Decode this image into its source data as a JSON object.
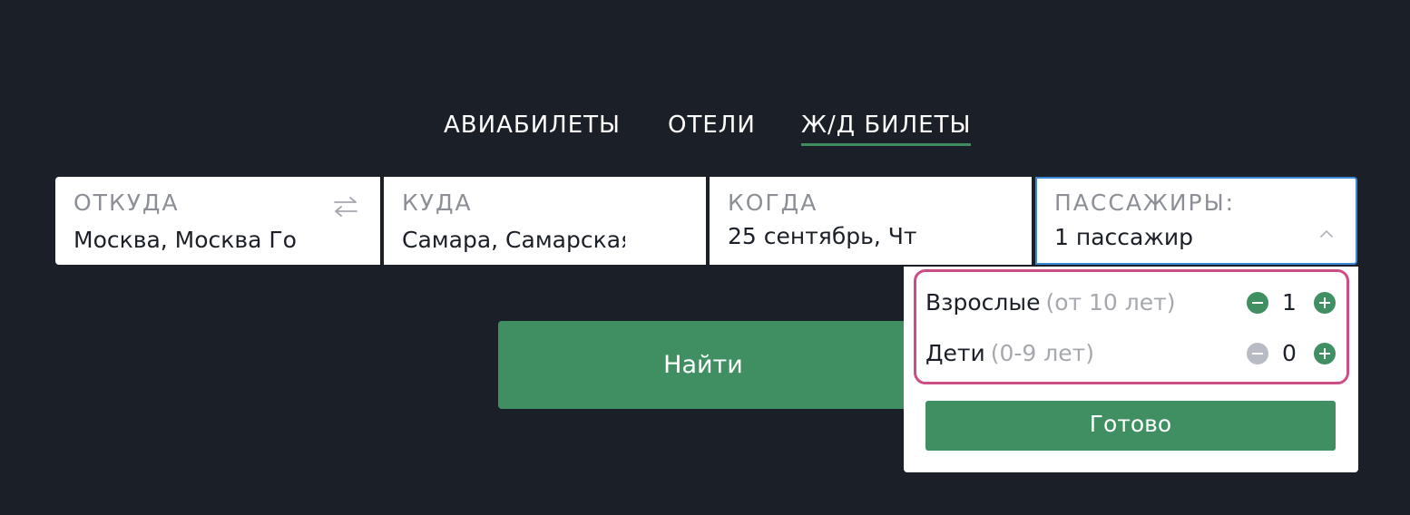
{
  "tabs": [
    {
      "label": "АВИАБИЛЕТЫ",
      "active": false
    },
    {
      "label": "ОТЕЛИ",
      "active": false
    },
    {
      "label": "Ж/Д БИЛЕТЫ",
      "active": true
    }
  ],
  "search": {
    "from": {
      "label": "ОТКУДА",
      "value": "Москва, Москва Город"
    },
    "to": {
      "label": "КУДА",
      "value": "Самара, Самарская область"
    },
    "when": {
      "label": "КОГДА",
      "value": "25 сентябрь, Чт"
    },
    "passengers": {
      "label": "ПАССАЖИРЫ:",
      "value": "1 пассажир"
    },
    "swap_icon": "swap-arrows-icon",
    "dropdown_icon": "chevron-up-icon"
  },
  "find_button": {
    "label": "Найти"
  },
  "passengers_popup": {
    "adults": {
      "label": "Взрослые",
      "hint": "(от 10 лет)",
      "count": "1",
      "minus_enabled": true
    },
    "children": {
      "label": "Дети",
      "hint": "(0-9 лет)",
      "count": "0",
      "minus_enabled": false
    },
    "done_label": "Готово"
  },
  "colors": {
    "background": "#1b1f27",
    "accent": "#3f8f62",
    "focus_border": "#3b88d6",
    "highlight": "#cc4e84"
  }
}
